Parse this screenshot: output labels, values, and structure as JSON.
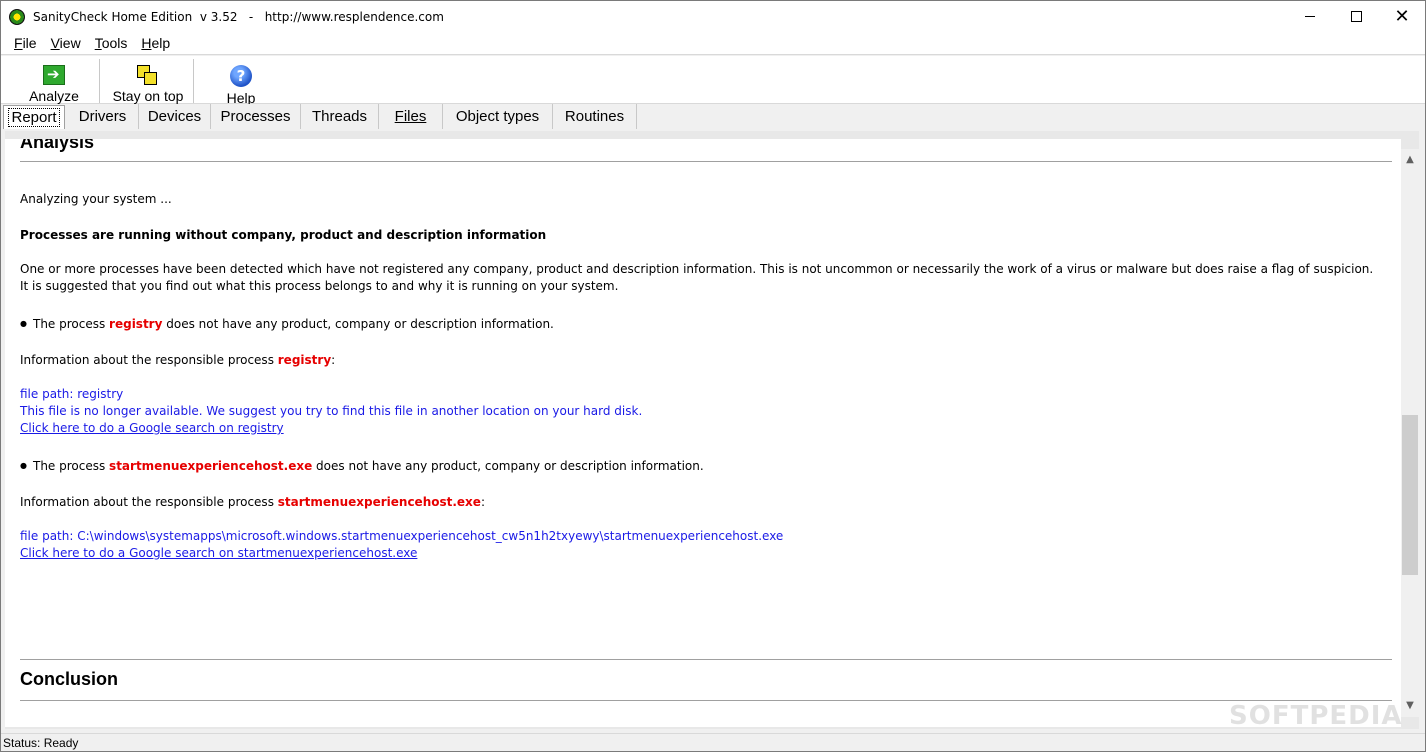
{
  "titlebar": {
    "title": "SanityCheck Home Edition  v 3.52   -   http://www.resplendence.com",
    "minimize_icon": "minimize-icon",
    "maximize_icon": "maximize-icon",
    "close_glyph": "✕"
  },
  "menu": {
    "items": [
      {
        "hot": "F",
        "rest": "ile"
      },
      {
        "hot": "V",
        "rest": "iew"
      },
      {
        "hot": "T",
        "rest": "ools"
      },
      {
        "hot": "H",
        "rest": "elp"
      }
    ]
  },
  "toolbar": {
    "analyze_label": "Analyze",
    "stay_on_top_label": "Stay on top",
    "help_label": "Help"
  },
  "tabs": [
    "Report",
    "Drivers",
    "Devices",
    "Processes",
    "Threads",
    "Files",
    "Object types",
    "Routines"
  ],
  "report": {
    "analysis_heading": "Analysis",
    "analyzing_text": "Analyzing your system ...",
    "finding_title": "Processes are running without company, product and description information",
    "finding_desc": "One or more processes have been detected which have not registered any company, product and description information. This is not uncommon or necessarily the work of a virus or malware but does raise a flag of suspicion. It is suggested that you find out what this process belongs to and why it is running on your system.",
    "bullet_glyph": "●",
    "process_prefix": "The process ",
    "process_suffix": " does not have any product, company or description information.",
    "info_prefix": "Information about the responsible process ",
    "info_suffix": ":",
    "items": [
      {
        "name": "registry",
        "file_path": "file path: registry",
        "unavailable": "This file is no longer available. We suggest you try to find this file in another location on your hard disk.",
        "search_link": "Click here to do a Google search on registry"
      },
      {
        "name": "startmenuexperiencehost.exe",
        "file_path": "file path: C:\\windows\\systemapps\\microsoft.windows.startmenuexperiencehost_cw5n1h2txyewy\\startmenuexperiencehost.exe",
        "search_link": "Click here to do a Google search on startmenuexperiencehost.exe"
      }
    ],
    "conclusion_heading": "Conclusion"
  },
  "status": {
    "text": "Status: Ready"
  },
  "watermark": "SOFTPEDIA",
  "colors": {
    "highlight_red": "#e60000",
    "link_blue": "#1a1ae6"
  }
}
